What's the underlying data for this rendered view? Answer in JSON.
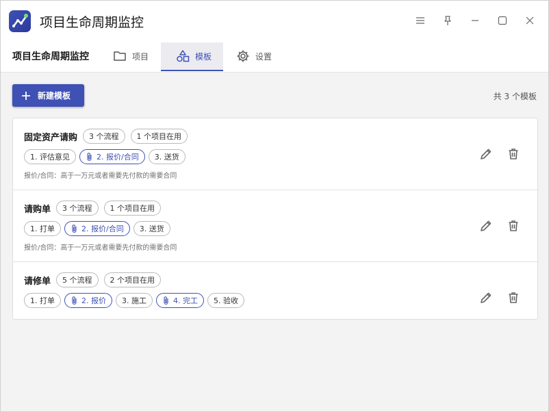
{
  "app": {
    "title": "项目生命周期监控"
  },
  "nav": {
    "app_name": "项目生命周期监控",
    "tabs": [
      {
        "label": "项目",
        "icon": "folder-icon"
      },
      {
        "label": "模板",
        "icon": "shapes-icon",
        "active": true
      },
      {
        "label": "设置",
        "icon": "gear-icon"
      }
    ]
  },
  "toolbar": {
    "new_label": "新建模板",
    "count_text": "共 3 个模板"
  },
  "colors": {
    "accent": "#3f51b5"
  },
  "templates": [
    {
      "name": "固定资产请购",
      "flows": "3 个流程",
      "in_use": "1 个项目在用",
      "stages": [
        {
          "label": "1. 评估意见",
          "attach": false
        },
        {
          "label": "2. 报价/合同",
          "attach": true
        },
        {
          "label": "3. 送货",
          "attach": false
        }
      ],
      "desc": "报价/合同：高于一万元或者需要先付款的需要合同"
    },
    {
      "name": "请购单",
      "flows": "3 个流程",
      "in_use": "1 个项目在用",
      "stages": [
        {
          "label": "1. 打单",
          "attach": false
        },
        {
          "label": "2. 报价/合同",
          "attach": true
        },
        {
          "label": "3. 送货",
          "attach": false
        }
      ],
      "desc": "报价/合同：高于一万元或者需要先付款的需要合同"
    },
    {
      "name": "请修单",
      "flows": "5 个流程",
      "in_use": "2 个项目在用",
      "stages": [
        {
          "label": "1. 打单",
          "attach": false
        },
        {
          "label": "2. 报价",
          "attach": true
        },
        {
          "label": "3. 施工",
          "attach": false
        },
        {
          "label": "4. 完工",
          "attach": true
        },
        {
          "label": "5. 验收",
          "attach": false
        }
      ],
      "desc": ""
    }
  ]
}
